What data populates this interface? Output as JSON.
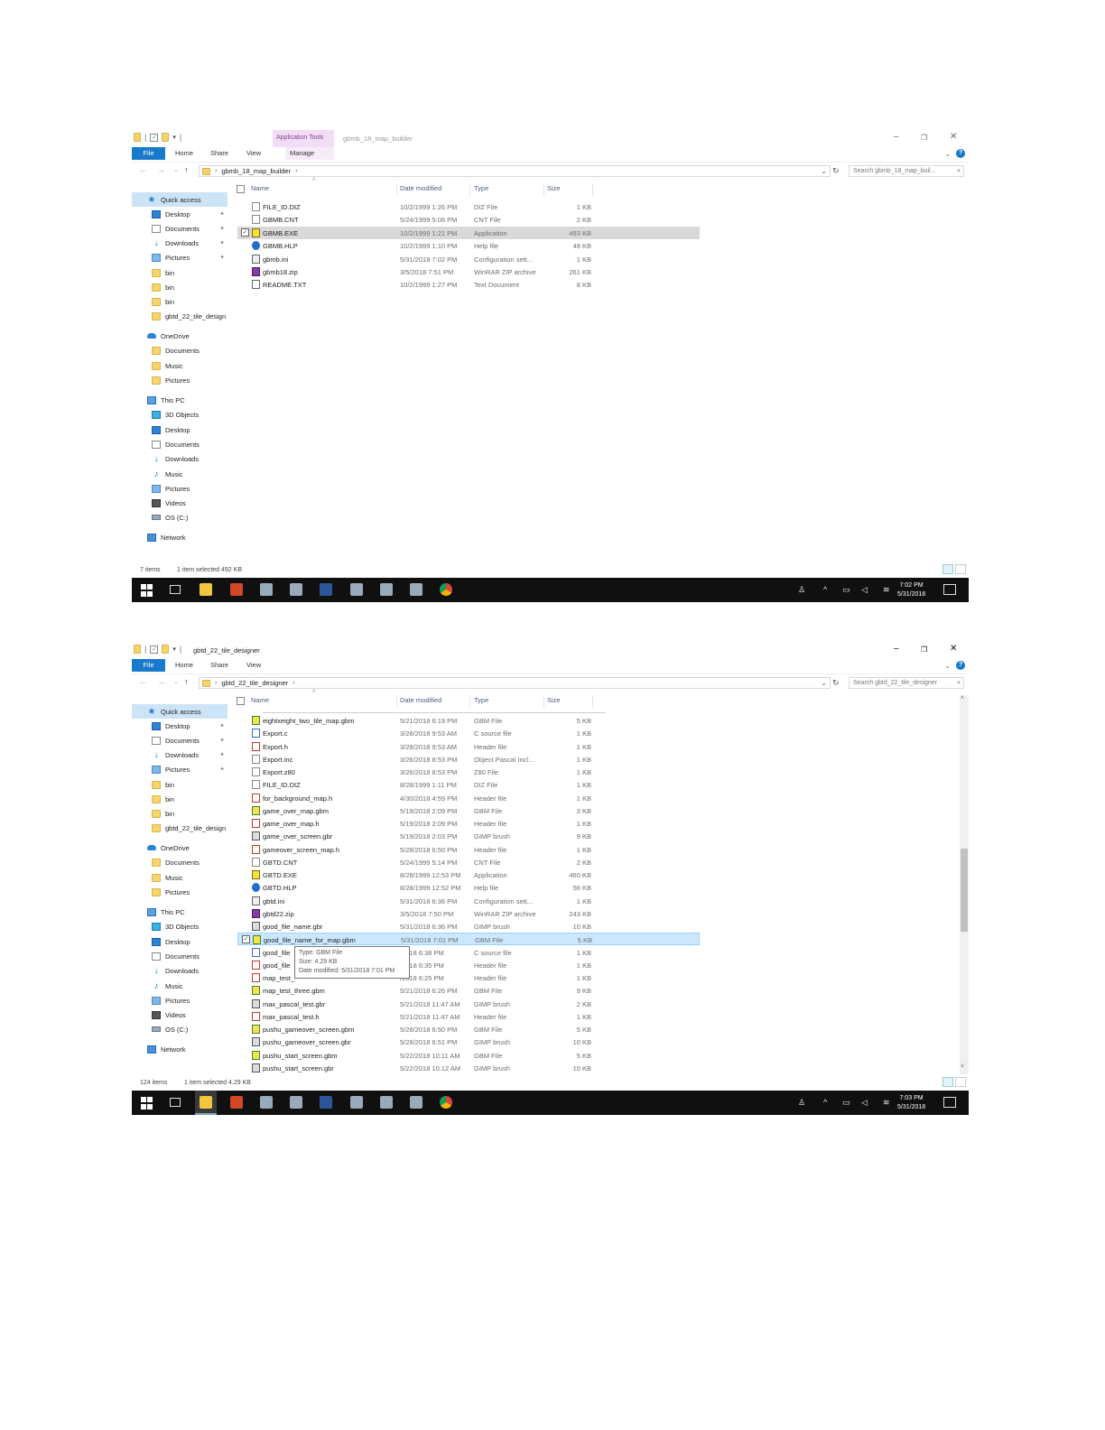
{
  "window1": {
    "context_tab": "Application Tools",
    "title": "gbmb_18_map_builder",
    "ribbon_tabs": [
      "File",
      "Home",
      "Share",
      "View",
      "Manage"
    ],
    "breadcrumb": "gbmb_18_map_builder",
    "search_placeholder": "Search gbmb_18_map_buil...",
    "columns": [
      "Name",
      "Date modified",
      "Type",
      "Size"
    ],
    "files": [
      {
        "name": "FILE_ID.DIZ",
        "date": "10/2/1999 1:26 PM",
        "type": "DIZ File",
        "size": "1 KB",
        "icon": "generic-file-icon"
      },
      {
        "name": "GBMB.CNT",
        "date": "5/24/1999 5:06 PM",
        "type": "CNT File",
        "size": "2 KB",
        "icon": "generic-file-icon"
      },
      {
        "name": "GBMB.EXE",
        "date": "10/2/1999 1:21 PM",
        "type": "Application",
        "size": "493 KB",
        "icon": "application-icon"
      },
      {
        "name": "GBMB.HLP",
        "date": "10/2/1999 1:10 PM",
        "type": "Help file",
        "size": "49 KB",
        "icon": "help-file-icon"
      },
      {
        "name": "gbmb.ini",
        "date": "5/31/2018 7:02 PM",
        "type": "Configuration sett...",
        "size": "1 KB",
        "icon": "config-file-icon"
      },
      {
        "name": "gbmb18.zip",
        "date": "3/5/2018 7:51 PM",
        "type": "WinRAR ZIP archive",
        "size": "261 KB",
        "icon": "zip-archive-icon"
      },
      {
        "name": "README.TXT",
        "date": "10/2/1999 1:27 PM",
        "type": "Text Document",
        "size": "8 KB",
        "icon": "text-file-icon"
      }
    ],
    "status_items": "7 items",
    "status_selected": "1 item selected  492 KB",
    "clock_time": "7:02 PM",
    "clock_date": "5/31/2018"
  },
  "window2": {
    "title": "gbtd_22_tile_designer",
    "ribbon_tabs": [
      "File",
      "Home",
      "Share",
      "View"
    ],
    "breadcrumb": "gbtd_22_tile_designer",
    "search_placeholder": "Search gbtd_22_tile_designer",
    "columns": [
      "Name",
      "Date modified",
      "Type",
      "Size"
    ],
    "files": [
      {
        "name": "eightxeight_two_tile_map.gbm",
        "date": "5/21/2018 6:19 PM",
        "type": "GBM File",
        "size": "5 KB",
        "icon": "gbm-file-icon"
      },
      {
        "name": "Export.c",
        "date": "3/28/2018 9:53 AM",
        "type": "C source file",
        "size": "1 KB",
        "icon": "c-source-icon"
      },
      {
        "name": "Export.h",
        "date": "3/28/2018 9:53 AM",
        "type": "Header file",
        "size": "1 KB",
        "icon": "header-file-icon"
      },
      {
        "name": "Export.inc",
        "date": "3/26/2018 8:53 PM",
        "type": "Object Pascal Incl...",
        "size": "1 KB",
        "icon": "pascal-file-icon"
      },
      {
        "name": "Export.z80",
        "date": "3/26/2018 8:53 PM",
        "type": "Z80 File",
        "size": "1 KB",
        "icon": "generic-file-icon"
      },
      {
        "name": "FILE_ID.DIZ",
        "date": "8/28/1999 1:11 PM",
        "type": "DIZ File",
        "size": "1 KB",
        "icon": "generic-file-icon"
      },
      {
        "name": "for_background_map.h",
        "date": "4/30/2018 4:59 PM",
        "type": "Header file",
        "size": "1 KB",
        "icon": "header-file-icon"
      },
      {
        "name": "game_over_map.gbm",
        "date": "5/19/2018 2:09 PM",
        "type": "GBM File",
        "size": "3 KB",
        "icon": "gbm-file-icon"
      },
      {
        "name": "game_over_map.h",
        "date": "5/19/2018 2:09 PM",
        "type": "Header file",
        "size": "1 KB",
        "icon": "header-file-icon"
      },
      {
        "name": "game_over_screen.gbr",
        "date": "5/19/2018 2:03 PM",
        "type": "GIMP brush",
        "size": "9 KB",
        "icon": "gimp-brush-icon"
      },
      {
        "name": "gameover_screen_map.h",
        "date": "5/28/2018 6:50 PM",
        "type": "Header file",
        "size": "1 KB",
        "icon": "header-file-icon"
      },
      {
        "name": "GBTD.CNT",
        "date": "5/24/1999 5:14 PM",
        "type": "CNT File",
        "size": "2 KB",
        "icon": "generic-file-icon"
      },
      {
        "name": "GBTD.EXE",
        "date": "8/28/1999 12:53 PM",
        "type": "Application",
        "size": "460 KB",
        "icon": "application-icon"
      },
      {
        "name": "GBTD.HLP",
        "date": "8/28/1999 12:52 PM",
        "type": "Help file",
        "size": "56 KB",
        "icon": "help-file-icon"
      },
      {
        "name": "gbtd.ini",
        "date": "5/31/2018 6:36 PM",
        "type": "Configuration sett...",
        "size": "1 KB",
        "icon": "config-file-icon"
      },
      {
        "name": "gbtd22.zip",
        "date": "3/5/2018 7:50 PM",
        "type": "WinRAR ZIP archive",
        "size": "243 KB",
        "icon": "zip-archive-icon"
      },
      {
        "name": "good_file_name.gbr",
        "date": "5/31/2018 6:36 PM",
        "type": "GIMP brush",
        "size": "10 KB",
        "icon": "gimp-brush-icon"
      },
      {
        "name": "good_file_name_for_map.gbm",
        "date": "5/31/2018 7:01 PM",
        "type": "GBM File",
        "size": "5 KB",
        "icon": "gbm-file-icon"
      },
      {
        "name": "good_file",
        "date": "/2018 6:38 PM",
        "type": "C source file",
        "size": "1 KB",
        "icon": "c-source-icon"
      },
      {
        "name": "good_file",
        "date": "/2018 6:35 PM",
        "type": "Header file",
        "size": "1 KB",
        "icon": "header-file-icon"
      },
      {
        "name": "map_test_",
        "date": "/2018 6:25 PM",
        "type": "Header file",
        "size": "1 KB",
        "icon": "header-file-icon"
      },
      {
        "name": "map_test_three.gbm",
        "date": "5/21/2018 6:26 PM",
        "type": "GBM File",
        "size": "9 KB",
        "icon": "gbm-file-icon"
      },
      {
        "name": "max_pascal_test.gbr",
        "date": "5/21/2018 11:47 AM",
        "type": "GIMP brush",
        "size": "2 KB",
        "icon": "gimp-brush-icon"
      },
      {
        "name": "max_pascal_test.h",
        "date": "5/21/2018 11:47 AM",
        "type": "Header file",
        "size": "1 KB",
        "icon": "header-file-icon"
      },
      {
        "name": "pushu_gameover_screen.gbm",
        "date": "5/28/2018 6:50 PM",
        "type": "GBM File",
        "size": "5 KB",
        "icon": "gbm-file-icon"
      },
      {
        "name": "pushu_gameover_screen.gbr",
        "date": "5/28/2018 6:51 PM",
        "type": "GIMP brush",
        "size": "10 KB",
        "icon": "gimp-brush-icon"
      },
      {
        "name": "pushu_start_screen.gbm",
        "date": "5/22/2018 10:11 AM",
        "type": "GBM File",
        "size": "5 KB",
        "icon": "gbm-file-icon"
      },
      {
        "name": "pushu_start_screen.gbr",
        "date": "5/22/2018 10:12 AM",
        "type": "GIMP brush",
        "size": "10 KB",
        "icon": "gimp-brush-icon"
      }
    ],
    "tooltip": {
      "type": "Type: GBM File",
      "size": "Size: 4.29 KB",
      "date": "Date modified: 5/31/2018 7:01 PM"
    },
    "status_items": "124 items",
    "status_selected": "1 item selected  4.29 KB",
    "clock_time": "7:03 PM",
    "clock_date": "5/31/2018"
  },
  "nav_pane": [
    {
      "label": "Quick access",
      "icon": "star-icon",
      "level": 0,
      "pinned": false
    },
    {
      "label": "Desktop",
      "icon": "desktop-icon",
      "level": 1,
      "pinned": true
    },
    {
      "label": "Documents",
      "icon": "documents-icon",
      "level": 1,
      "pinned": true
    },
    {
      "label": "Downloads",
      "icon": "downloads-icon",
      "level": 1,
      "pinned": true
    },
    {
      "label": "Pictures",
      "icon": "pictures-icon",
      "level": 1,
      "pinned": true
    },
    {
      "label": "bin",
      "icon": "folder-icon",
      "level": 1,
      "pinned": false
    },
    {
      "label": "bin",
      "icon": "folder-icon",
      "level": 1,
      "pinned": false
    },
    {
      "label": "bin",
      "icon": "folder-icon",
      "level": 1,
      "pinned": false
    },
    {
      "label": "gbtd_22_tile_design",
      "icon": "folder-icon",
      "level": 1,
      "pinned": false
    },
    {
      "label": "OneDrive",
      "icon": "onedrive-icon",
      "level": 0,
      "pinned": false
    },
    {
      "label": "Documents",
      "icon": "folder-icon",
      "level": 1,
      "pinned": false
    },
    {
      "label": "Music",
      "icon": "folder-icon",
      "level": 1,
      "pinned": false
    },
    {
      "label": "Pictures",
      "icon": "folder-icon",
      "level": 1,
      "pinned": false
    },
    {
      "label": "This PC",
      "icon": "this-pc-icon",
      "level": 0,
      "pinned": false
    },
    {
      "label": "3D Objects",
      "icon": "3d-objects-icon",
      "level": 1,
      "pinned": false
    },
    {
      "label": "Desktop",
      "icon": "desktop-icon",
      "level": 1,
      "pinned": false
    },
    {
      "label": "Documents",
      "icon": "documents-icon",
      "level": 1,
      "pinned": false
    },
    {
      "label": "Downloads",
      "icon": "downloads-icon",
      "level": 1,
      "pinned": false
    },
    {
      "label": "Music",
      "icon": "music-icon",
      "level": 1,
      "pinned": false
    },
    {
      "label": "Pictures",
      "icon": "pictures-icon",
      "level": 1,
      "pinned": false
    },
    {
      "label": "Videos",
      "icon": "videos-icon",
      "level": 1,
      "pinned": false
    },
    {
      "label": "OS (C:)",
      "icon": "drive-icon",
      "level": 1,
      "pinned": false
    },
    {
      "label": "Network",
      "icon": "network-icon",
      "level": 0,
      "pinned": false
    }
  ],
  "taskbar_apps": [
    "start-icon",
    "task-view-icon",
    "file-explorer-icon",
    "powerpoint-icon",
    "app-icon",
    "app-icon",
    "word-icon",
    "app-icon",
    "app-icon",
    "app-icon",
    "chrome-icon"
  ],
  "colors": {
    "accent": "#1979ca",
    "selection_blue": "#cce8ff",
    "selection_gray": "#d9d9d9",
    "context_tab": "#f3dcf6",
    "taskbar": "#101010"
  }
}
